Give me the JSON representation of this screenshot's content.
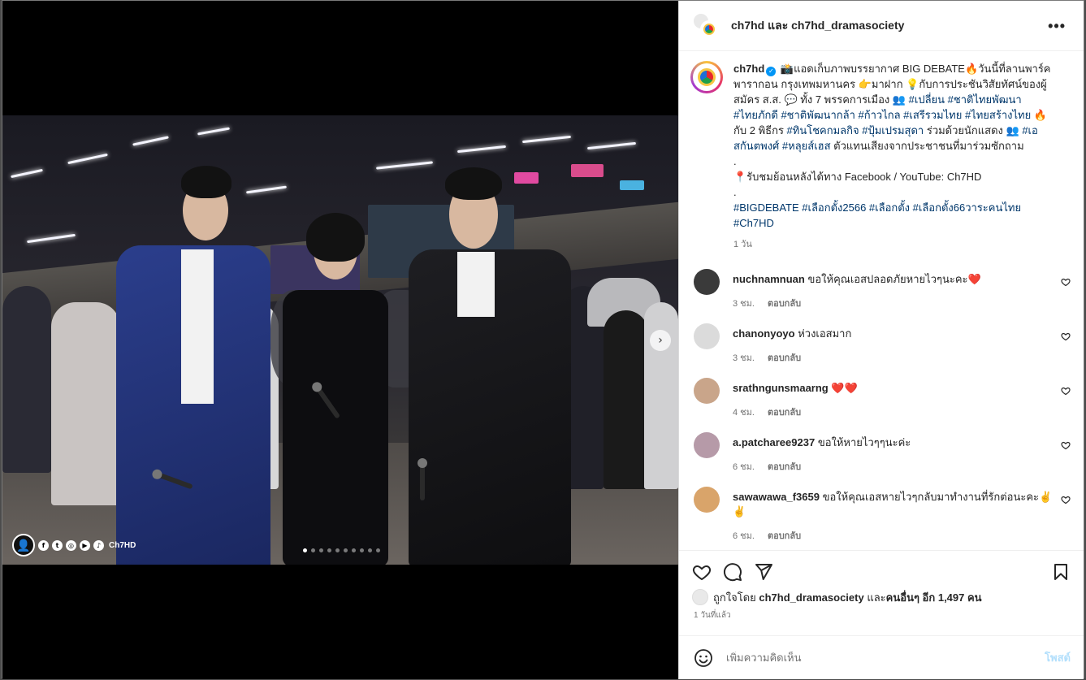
{
  "header": {
    "title": "ch7hd และ ch7hd_dramasociety"
  },
  "media": {
    "watermark_text": "Ch7HD",
    "carousel_count": 10,
    "carousel_active": 0
  },
  "caption": {
    "username": "ch7hd",
    "lines": [
      "📸แอดเก็บภาพบรรยากาศ BIG DEBATE🔥วันนี้ที่ลานพาร์ค",
      "พารากอน กรุงเทพมหานคร 👉มาฝาก 💡กับการประชันวิสัยทัศน์ของผู้",
      "สมัคร ส.ส. 💬 ทั้ง 7 พรรคการเมือง 👥 ",
      "",
      "กับ 2 พิธีกร ",
      "",
      ".",
      "📍รับชมย้อนหลังได้ทาง Facebook / YouTube: Ch7HD",
      "."
    ],
    "tags_line3": "#เปลี่ยน #ชาติไทยพัฒนา",
    "tags_line4": "#ไทยภักดี #ชาติพัฒนากล้า #ก้าวไกล #เสรีรวมไทย #ไทยสร้างไทย 🔥",
    "tags_line5": "#ทินโชคกมลกิจ #ปุ้มเปรมสุดา",
    "line5_tail": " ร่วมด้วยนักแสดง 👥 ",
    "tags_line5b": "#เอ",
    "tags_line6": "สกันตพงศ์ #หลุยส์เฮส",
    "line6_tail": " ตัวแทนเสียงจากประชาชนที่มาร่วมซักถาม",
    "hashtags_1": "#BIGDEBATE #เลือกตั้ง2566 #เลือกตั้ง #เลือกตั้ง66วาระคนไทย",
    "hashtags_2": "#Ch7HD",
    "time": "1 วัน"
  },
  "comments": [
    {
      "user": "nuchnamnuan",
      "text": "ขอให้คุณเอสปลอดภัยหายไวๆนะคะ❤️",
      "time": "3 ชม.",
      "reply": "ตอบกลับ",
      "avatar_color": "#3a3a3a"
    },
    {
      "user": "chanonyoyo",
      "text": "ห่วงเอสมาก",
      "time": "3 ชม.",
      "reply": "ตอบกลับ",
      "avatar_color": "#dbdbdb"
    },
    {
      "user": "srathngunsmaarng",
      "text": "❤️❤️",
      "time": "4 ชม.",
      "reply": "ตอบกลับ",
      "avatar_color": "#c9a58a"
    },
    {
      "user": "a.patcharee9237",
      "text": "ขอให้หายไวๆๆนะค่ะ",
      "time": "6 ชม.",
      "reply": "ตอบกลับ",
      "avatar_color": "#b69aa8"
    },
    {
      "user": "sawawawa_f3659",
      "text": "ขอให้คุณเอสหายไวๆกลับมาทำงานที่รักต่อนะคะ✌️✌️",
      "time": "6 ชม.",
      "reply": "ตอบกลับ",
      "avatar_color": "#d9a46a"
    }
  ],
  "likes": {
    "prefix": "ถูกใจโดย ",
    "user": "ch7hd_dramasociety",
    "middle": " และ",
    "others": "คนอื่นๆ อีก 1,497 คน"
  },
  "time_ago": "1 วันที่แล้ว",
  "add_comment": {
    "placeholder": "เพิ่มความคิดเห็น",
    "post_label": "โพสต์"
  },
  "icons": {
    "more": "more-icon",
    "heart": "heart-icon",
    "comment": "comment-icon",
    "share": "share-icon",
    "save": "bookmark-icon",
    "emoji": "emoji-icon",
    "next": "chevron-right-icon"
  }
}
